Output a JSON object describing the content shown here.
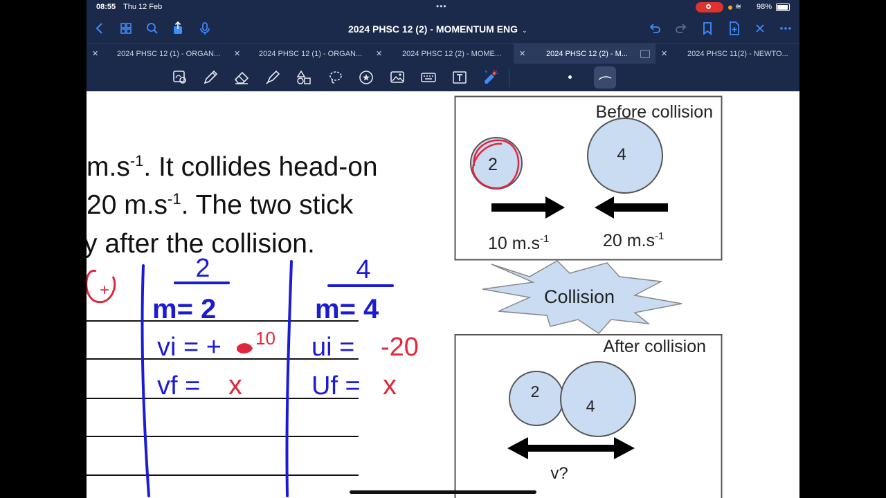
{
  "status": {
    "time": "08:55",
    "date": "Thu 12 Feb",
    "battery": "98%"
  },
  "nav": {
    "title": "2024 PHSC 12 (2) - MOMENTUM ENG"
  },
  "tabs": [
    {
      "label": "2024 PHSC 12 (1) - ORGAN..."
    },
    {
      "label": "2024 PHSC 12 (1) - ORGAN..."
    },
    {
      "label": "2024 PHSC 12 (2) - MOME..."
    },
    {
      "label": "2024 PHSC 12 (2) - M..."
    },
    {
      "label": "2024 PHSC 11(2) - NEWTO..."
    }
  ],
  "toolbar": {
    "icons": [
      "shape-recognition-icon",
      "pen-icon",
      "eraser-icon",
      "highlighter-icon",
      "shapes-icon",
      "lasso-icon",
      "sticker-icon",
      "image-icon",
      "keyboard-icon",
      "text-icon",
      "laser-pointer-icon"
    ]
  },
  "question": {
    "line1_a": "m.s",
    "line1_sup": "-1",
    "line1_b": ". It collides head-on",
    "line2_a": "20 m.s",
    "line2_sup": "-1",
    "line2_b": ". The two stick",
    "line3": "y after the collision."
  },
  "diagram": {
    "before_label": "Before collision",
    "ball_small": "2",
    "ball_large": "4",
    "speed_left_a": "10 m.s",
    "speed_left_sup": "-1",
    "speed_right_a": "20 m.s",
    "speed_right_sup": "-1",
    "collision_label": "Collision",
    "after_label": "After collision",
    "final_velocity": "v?"
  },
  "notes": {
    "col1_head": "2",
    "col2_head": "4",
    "m1": "m= 2",
    "vi1": "vi = +",
    "vi1_value": "10",
    "vf1": "vf = ",
    "unknown": "x",
    "m2": "m= 4",
    "vi2": "ui = ",
    "vi2_value": "-20",
    "vf2": "Uf = "
  },
  "colors": {
    "ink_blue": "#1b1bd6",
    "ink_red": "#e0283c",
    "nav_bg": "#1b2a4a",
    "accent": "#3f8cff",
    "ball_fill": "#c9dcf1"
  }
}
